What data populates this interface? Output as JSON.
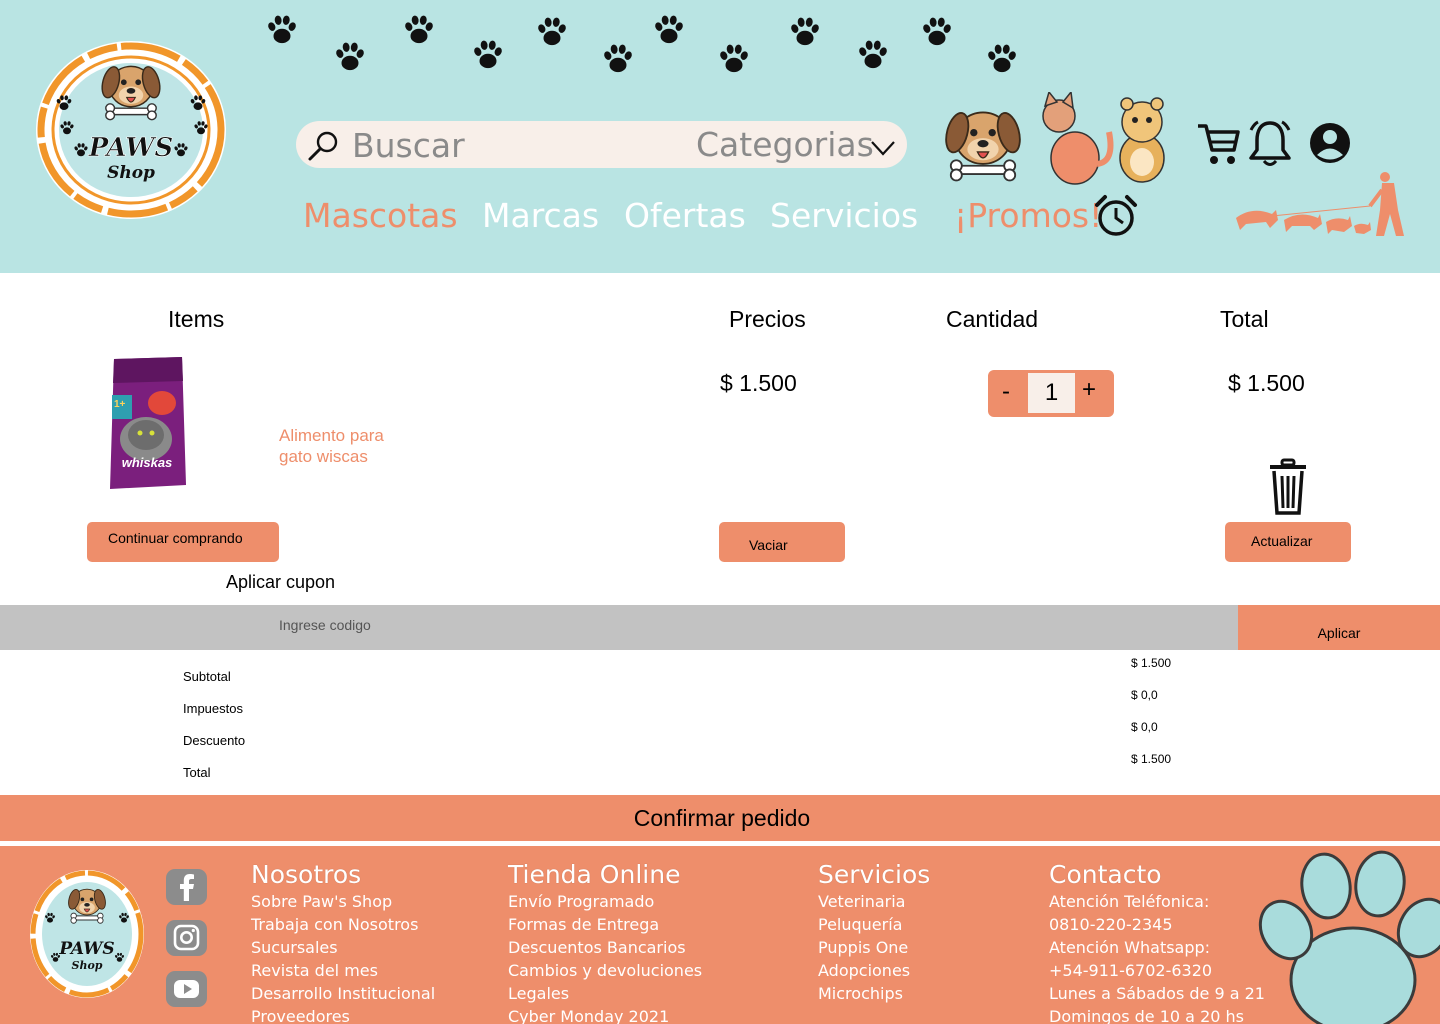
{
  "brand": {
    "logo_line1": "PAWS",
    "logo_line2": "Shop"
  },
  "search": {
    "placeholder": "Buscar",
    "categories_label": "Categorias"
  },
  "nav": {
    "mascotas": "Mascotas",
    "marcas": "Marcas",
    "ofertas": "Ofertas",
    "servicios": "Servicios",
    "promos": "¡Promos!"
  },
  "colors": {
    "header_bg": "#b9e4e3",
    "accent": "#ee8e6b",
    "coupon_bar": "#c2c2c2",
    "nav_highlight": "#ee8e6b",
    "nav_default": "#ffffff"
  },
  "header_icons": [
    "cart-icon",
    "bell-icon",
    "user-icon",
    "alarm-icon"
  ],
  "cart": {
    "headers": {
      "items": "Items",
      "precios": "Precios",
      "cantidad": "Cantidad",
      "total": "Total"
    },
    "item": {
      "image_brand": "whiskas",
      "name": "Alimento para gato wiscas",
      "price": "$ 1.500",
      "quantity": "1",
      "total": "$ 1.500"
    },
    "qty_minus": "-",
    "qty_plus": "+",
    "continue_label": "Continuar comprando",
    "empty_label": "Vaciar",
    "update_label": "Actualizar"
  },
  "coupon": {
    "title": "Aplicar cupon",
    "placeholder": "Ingrese codigo",
    "apply_label": "Aplicar"
  },
  "summary": [
    {
      "label": "Subtotal",
      "value": "$ 1.500"
    },
    {
      "label": "Impuestos",
      "value": "$ 0,0"
    },
    {
      "label": "Descuento",
      "value": "$ 0,0"
    },
    {
      "label": "Total",
      "value": "$ 1.500"
    }
  ],
  "confirm_label": "Confirmar pedido",
  "footer": {
    "social": [
      "facebook-icon",
      "instagram-icon",
      "youtube-icon"
    ],
    "columns": [
      {
        "title": "Nosotros",
        "items": [
          "Sobre Paw's Shop",
          "Trabaja con Nosotros",
          "Sucursales",
          "Revista del mes",
          "Desarrollo Institucional",
          "Proveedores"
        ]
      },
      {
        "title": "Tienda Online",
        "items": [
          "Envío Programado",
          "Formas de Entrega",
          "Descuentos Bancarios",
          "Cambios y devoluciones",
          "Legales",
          "Cyber Monday 2021"
        ]
      },
      {
        "title": "Servicios",
        "items": [
          "Veterinaria",
          "Peluquería",
          "Puppis One",
          "Adopciones",
          "Microchips"
        ]
      },
      {
        "title": "Contacto",
        "items": [
          "Atención Teléfonica:",
          "0810-220-2345",
          "Atención Whatsapp:",
          "+54-911-6702-6320",
          "Lunes a Sábados de 9 a 21",
          "Domingos de 10 a 20 hs"
        ]
      }
    ]
  }
}
